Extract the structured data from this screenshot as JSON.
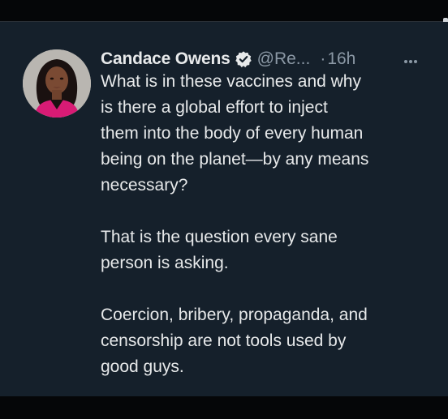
{
  "tweet": {
    "author_name": "Candace Owens",
    "handle": "@Re...",
    "separator": "·",
    "time": "16h",
    "paragraphs": [
      "What is in these vaccines and why\nis there a global effort to inject\nthem into the body of every human\nbeing on the planet—by any means\nnecessary?",
      "That is the question every sane\nperson is asking.",
      "Coercion, bribery, propaganda, and\ncensorship are not tools used by\ngood guys."
    ]
  },
  "icons": {
    "verified": "verified-badge-icon",
    "more": "more-options-icon"
  },
  "colors": {
    "background": "#15202b",
    "primary_text": "#e7e9ea",
    "secondary_text": "#8b98a5",
    "avatar_accent": "#d81b75"
  }
}
